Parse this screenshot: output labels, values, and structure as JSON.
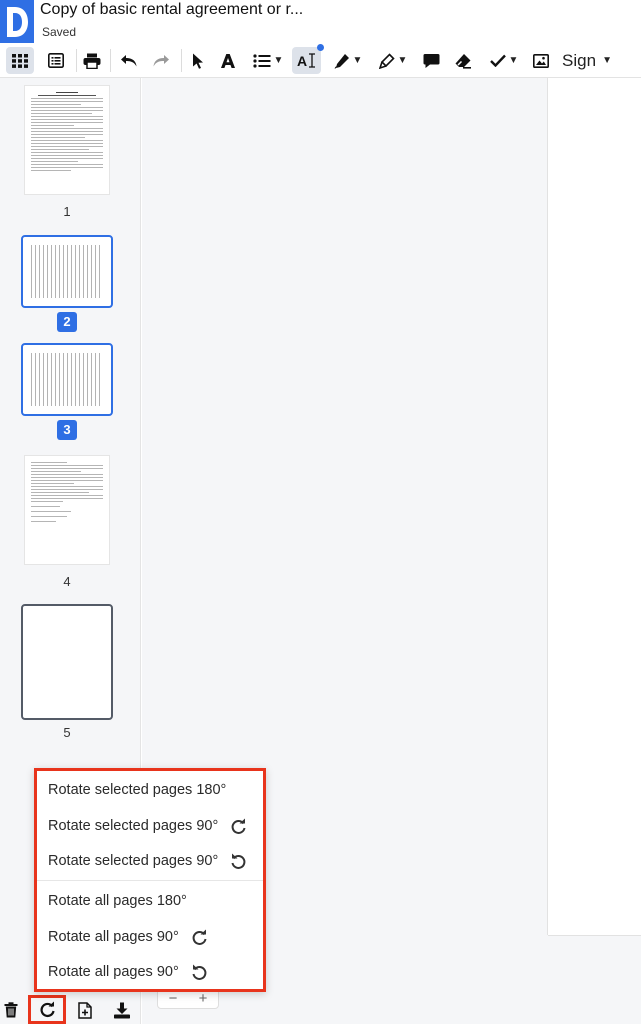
{
  "header": {
    "title": "Copy of basic rental agreement or r...",
    "status": "Saved",
    "brand_color": "#2f6fe4"
  },
  "toolbar": {
    "items": [
      {
        "name": "grid-view",
        "icon": "grid-icon"
      },
      {
        "name": "list-view",
        "icon": "list-icon"
      },
      {
        "name": "print",
        "icon": "printer-icon"
      },
      {
        "name": "undo",
        "icon": "undo-icon"
      },
      {
        "name": "redo",
        "icon": "redo-icon"
      },
      {
        "name": "select",
        "icon": "cursor-icon"
      },
      {
        "name": "add-text",
        "icon": "text-icon"
      },
      {
        "name": "list-format",
        "icon": "bulleted-list-icon"
      },
      {
        "name": "text-edit",
        "icon": "text-cursor-icon"
      },
      {
        "name": "draw",
        "icon": "pen-icon"
      },
      {
        "name": "highlight",
        "icon": "highlighter-icon"
      },
      {
        "name": "comment",
        "icon": "comment-icon"
      },
      {
        "name": "erase",
        "icon": "eraser-icon"
      },
      {
        "name": "checkmark",
        "icon": "check-icon"
      },
      {
        "name": "image",
        "icon": "image-icon"
      }
    ],
    "sign_label": "Sign",
    "text_edit_label": "A"
  },
  "sidebar": {
    "pages": [
      {
        "number": "1",
        "selected": false
      },
      {
        "number": "2",
        "selected": true
      },
      {
        "number": "3",
        "selected": true
      },
      {
        "number": "4",
        "selected": false
      },
      {
        "number": "5",
        "selected": false
      }
    ],
    "selection_color": "#2f6fe4"
  },
  "rotate_menu": {
    "items": [
      {
        "label": "Rotate selected pages 180°",
        "icon": null
      },
      {
        "label": "Rotate selected pages 90°",
        "icon": "rotate-clockwise-icon"
      },
      {
        "label": "Rotate selected pages 90°",
        "icon": "rotate-counterclockwise-icon"
      },
      {
        "label": "Rotate all pages 180°",
        "icon": null
      },
      {
        "label": "Rotate all pages 90°",
        "icon": "rotate-clockwise-icon"
      },
      {
        "label": "Rotate all pages 90°",
        "icon": "rotate-counterclockwise-icon"
      }
    ],
    "highlight_color": "#e8341c"
  },
  "zoom": {
    "minus": "−",
    "plus": "+"
  },
  "bottom_bar": {
    "items": [
      {
        "name": "delete",
        "icon": "trash-icon"
      },
      {
        "name": "rotate",
        "icon": "rotate-clockwise-icon"
      },
      {
        "name": "insert-page",
        "icon": "add-page-icon"
      },
      {
        "name": "download",
        "icon": "download-icon"
      }
    ]
  }
}
